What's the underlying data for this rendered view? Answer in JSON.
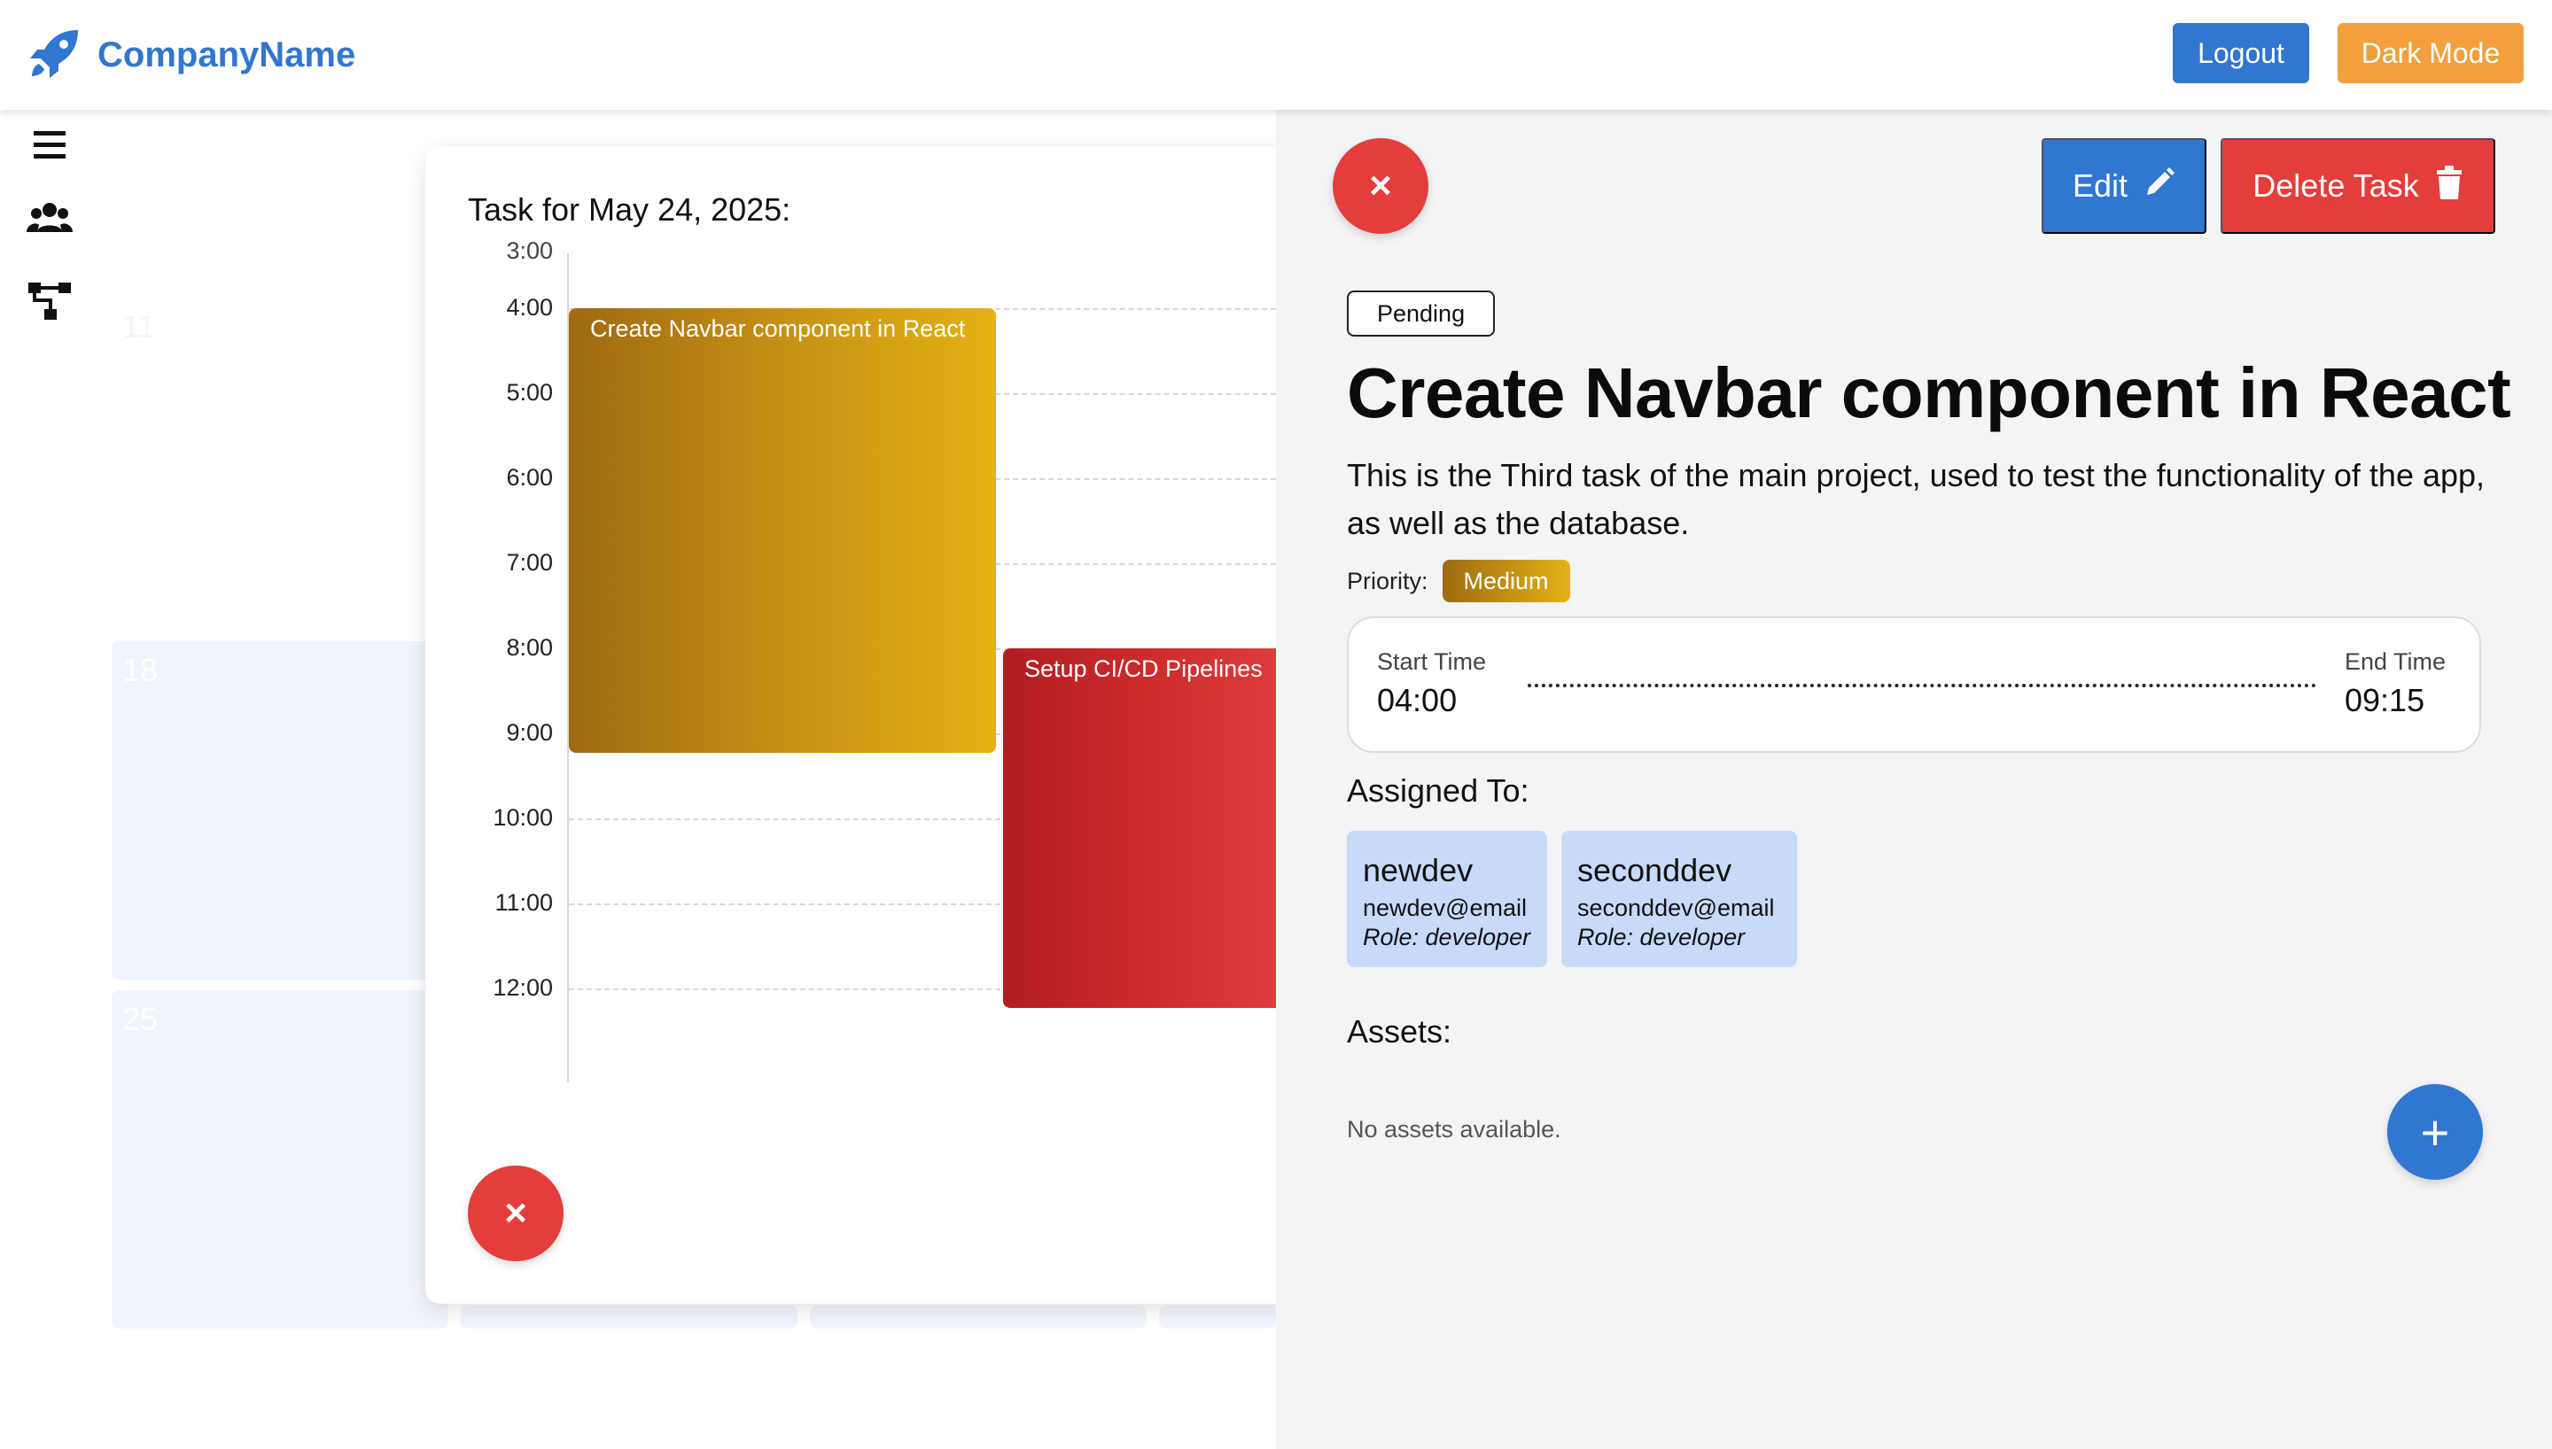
{
  "navbar": {
    "brand_name": "CompanyName",
    "brand_icon": "rocket-icon",
    "logout_label": "Logout",
    "dark_mode_label": "Dark Mode"
  },
  "sidebar": {
    "items": [
      {
        "icon": "menu-icon"
      },
      {
        "icon": "users-icon"
      },
      {
        "icon": "hierarchy-icon"
      }
    ]
  },
  "calendar": {
    "day_numbers": [
      "11",
      "18",
      "25"
    ]
  },
  "day_view": {
    "title": "Task for May 24, 2025:",
    "partial_top_label": "3:00",
    "hours": [
      "4:00",
      "5:00",
      "6:00",
      "7:00",
      "8:00",
      "9:00",
      "10:00",
      "11:00",
      "12:00"
    ],
    "events": [
      {
        "label": "Create Navbar component in React",
        "start": "04:00",
        "end": "09:15"
      },
      {
        "label": "Setup CI/CD Pipelines",
        "start": "08:00",
        "end": "12:15"
      }
    ],
    "close_label": "×"
  },
  "task": {
    "close_label": "×",
    "edit_label": "Edit",
    "delete_label": "Delete Task",
    "status": "Pending",
    "title": "Create Navbar component in React",
    "description": "This is the Third task of the main project, used to test the functionality of the app, as well as the database.",
    "priority_label": "Priority:",
    "priority": "Medium",
    "start_label": "Start Time",
    "start_time": "04:00",
    "end_label": "End Time",
    "end_time": "09:15",
    "assigned_title": "Assigned To:",
    "assignees": [
      {
        "name": "newdev",
        "email": "newdev@email",
        "role": "Role: developer"
      },
      {
        "name": "seconddev",
        "email": "seconddev@email",
        "role": "Role: developer"
      }
    ],
    "assets_title": "Assets:",
    "no_assets": "No assets available.",
    "add_label": "+"
  },
  "colors": {
    "primary": "#3176d0",
    "danger": "#e53c3c",
    "warning": "#f2a03d",
    "medium_priority_start": "#9d6b12",
    "medium_priority_end": "#e4b214",
    "assignee_bg": "#c8dafa"
  }
}
